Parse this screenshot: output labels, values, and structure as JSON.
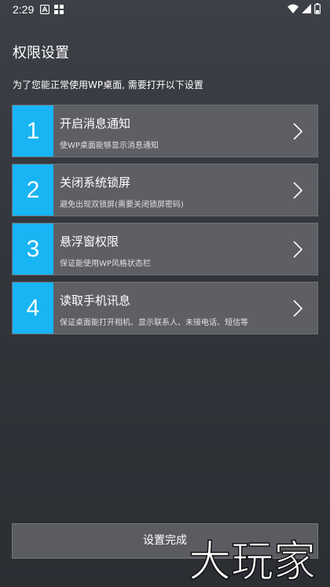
{
  "status_bar": {
    "time": "2:29",
    "icons": [
      "android-auto-icon",
      "apps-grid-icon",
      "wifi-icon",
      "signal-icon",
      "battery-icon"
    ]
  },
  "page": {
    "title": "权限设置",
    "subtitle": "为了您能正常使用WP桌面, 需要打开以下设置"
  },
  "permissions": [
    {
      "number": "1",
      "title": "开启消息通知",
      "desc": "使WP桌面能够显示消息通知"
    },
    {
      "number": "2",
      "title": "关闭系统锁屏",
      "desc": "避免出现双锁屏(需要关闭锁屏密码)"
    },
    {
      "number": "3",
      "title": "悬浮窗权限",
      "desc": "保证能使用WP风格状态栏"
    },
    {
      "number": "4",
      "title": "读取手机讯息",
      "desc": "保证桌面能打开相机、显示联系人、未接电话、短信等"
    }
  ],
  "footer": {
    "done_label": "设置完成"
  },
  "watermark": {
    "text": "大玩家"
  },
  "colors": {
    "accent": "#18b4f3",
    "item_bg": "#5e5f64",
    "background": "#35383e"
  }
}
